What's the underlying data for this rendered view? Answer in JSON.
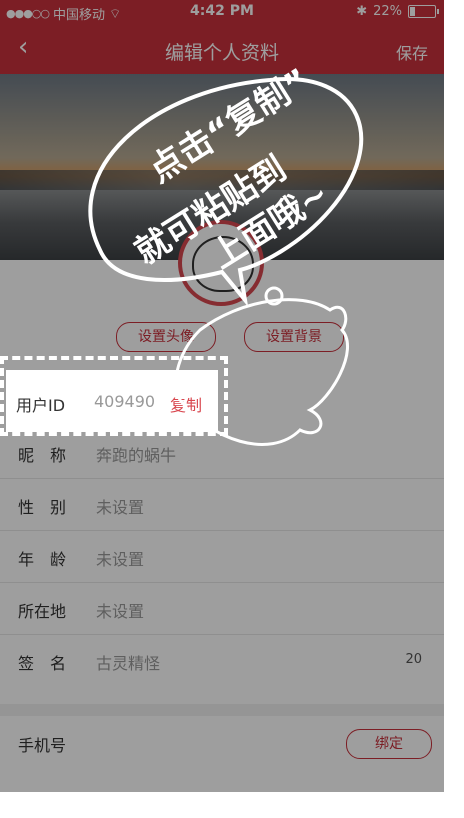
{
  "status": {
    "carrier": "中国移动",
    "time": "4:42 PM",
    "battery": "22%",
    "battery_level": 0.22
  },
  "nav": {
    "back_icon": "chevron-left-icon",
    "title": "编辑个人资料",
    "save": "保存"
  },
  "profile_buttons": {
    "set_avatar": "设置头像",
    "set_background": "设置背景"
  },
  "rows": {
    "user_id": {
      "label": "用户ID",
      "value": "409490",
      "copy": "复制"
    },
    "nickname": {
      "label": "昵　称",
      "value": "奔跑的蜗牛"
    },
    "gender": {
      "label": "性　别",
      "value": "未设置"
    },
    "age": {
      "label": "年　龄",
      "value": "未设置"
    },
    "location": {
      "label": "所在地",
      "value": "未设置"
    },
    "signature": {
      "label": "签　名",
      "value": "古灵精怪",
      "count": "20"
    },
    "phone": {
      "label": "手机号",
      "bind": "绑定"
    }
  },
  "annotation": {
    "line1": "点击“复制”",
    "line2": "就可粘贴到",
    "line3": "上面哦~"
  },
  "colors": {
    "brand": "#c9313c",
    "accent": "#d9474f"
  }
}
